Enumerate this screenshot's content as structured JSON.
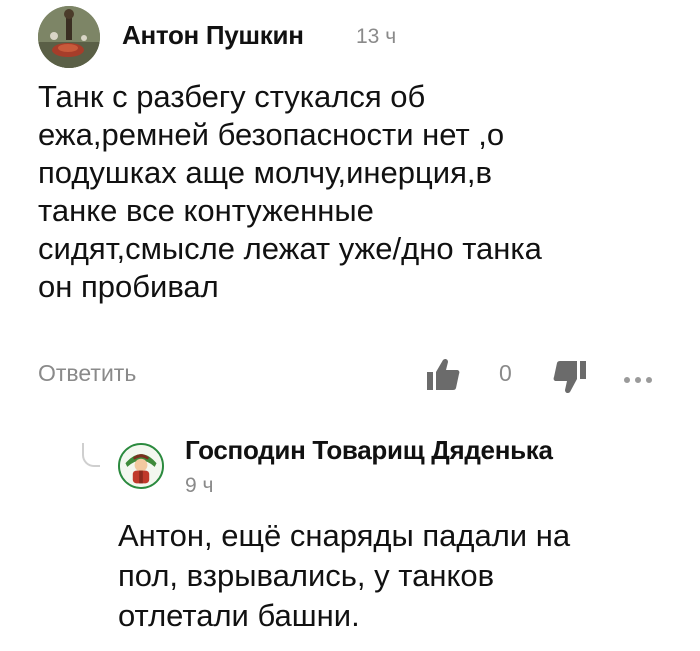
{
  "comment": {
    "author": "Антон Пушкин",
    "time": "13 ч",
    "text": "Танк с разбегу стукался об\nежа,ремней безопасности нет ,о\nподушках аще молчу,инерция,в\nтанке все контуженные\nсидят,смысле лежат уже/дно танка\nон пробивал",
    "avatar_icon": "user-avatar-photo",
    "actions": {
      "reply_label": "Ответить",
      "score": "0",
      "like_icon": "thumbs-up-icon",
      "dislike_icon": "thumbs-down-icon",
      "more_icon": "more-dots-icon"
    }
  },
  "reply": {
    "author": "Господин Товарищ Дяденька",
    "time": "9 ч",
    "text": "Антон, ещё снаряды падали на\nпол, взрывались, у танков\nотлетали башни.",
    "avatar_icon": "user-avatar-illustration"
  },
  "colors": {
    "text": "#111111",
    "muted": "#8a8a8a",
    "icon": "#6b6b6b"
  }
}
